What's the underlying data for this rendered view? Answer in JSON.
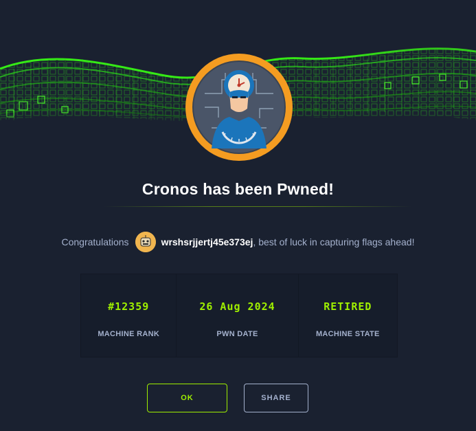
{
  "dialog": {
    "title": "Cronos has been Pwned!",
    "congrats_prefix": "Congratulations",
    "username": "wrshsrjjertj45e373ej",
    "congrats_suffix": ", best of luck in capturing flags ahead!"
  },
  "stats": [
    {
      "value": "#12359",
      "label": "MACHINE RANK"
    },
    {
      "value": "26 Aug 2024",
      "label": "PWN DATE"
    },
    {
      "value": "RETIRED",
      "label": "MACHINE STATE"
    }
  ],
  "buttons": {
    "ok": "OK",
    "share": "SHARE"
  },
  "colors": {
    "background": "#1a2130",
    "accent": "#9fef00",
    "muted": "#a4b1cd",
    "avatar_ring": "#f49c21"
  },
  "icons": {
    "machine_avatar": "cronos-machine-icon",
    "user_avatar": "user-avatar-icon"
  }
}
